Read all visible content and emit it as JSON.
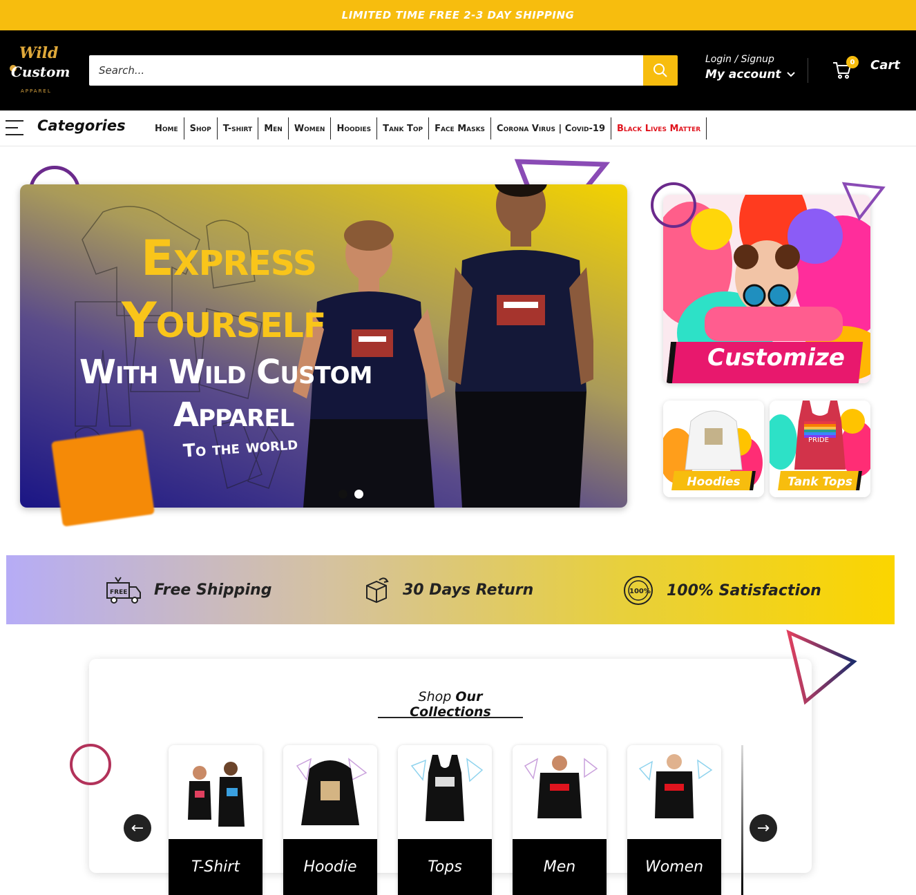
{
  "announcement": "LIMITED TIME FREE 2-3 DAY SHIPPING",
  "logo": {
    "line1": "Wild",
    "line2": "Custom",
    "line3": "APPAREL"
  },
  "search": {
    "placeholder": "Search..."
  },
  "account": {
    "login_label": "Login / Signup",
    "account_label": "My account"
  },
  "cart": {
    "count": "0",
    "label": "Cart"
  },
  "nav": {
    "categories_label": "Categories",
    "links": [
      {
        "label": "Home"
      },
      {
        "label": "Shop"
      },
      {
        "label": "T-shirt"
      },
      {
        "label": "Men"
      },
      {
        "label": "Women"
      },
      {
        "label": "Hoodies"
      },
      {
        "label": "Tank Top"
      },
      {
        "label": "Face Masks"
      },
      {
        "label": "Corona Virus | Covid-19"
      },
      {
        "label": "Black Lives Matter"
      }
    ]
  },
  "hero": {
    "line1": "Express",
    "line2": "Yourself",
    "line3": "With Wild Custom",
    "line4": "Apparel",
    "line5": "To the world"
  },
  "promo": {
    "customize_label": "Customize",
    "hoodies_label": "Hoodies",
    "tank_tops_label": "Tank Tops",
    "tank_print": "PRIDE"
  },
  "features": [
    {
      "icon": "free-shipping-truck-icon",
      "label": "Free Shipping",
      "badge": "FREE"
    },
    {
      "icon": "return-box-icon",
      "label": "30 Days Return"
    },
    {
      "icon": "satisfaction-seal-icon",
      "label": "100% Satisfaction",
      "badge": "100%"
    }
  ],
  "collections": {
    "title_prefix": "Shop",
    "title_main": "Our Collections",
    "items": [
      {
        "label": "T-Shirt"
      },
      {
        "label": "Hoodie"
      },
      {
        "label": "Tops"
      },
      {
        "label": "Men"
      },
      {
        "label": "Women"
      }
    ]
  },
  "colors": {
    "accent": "#f7bd0e",
    "header_bg": "#000000",
    "alert_link": "#e0141e",
    "customize_pink": "#e8186d"
  }
}
